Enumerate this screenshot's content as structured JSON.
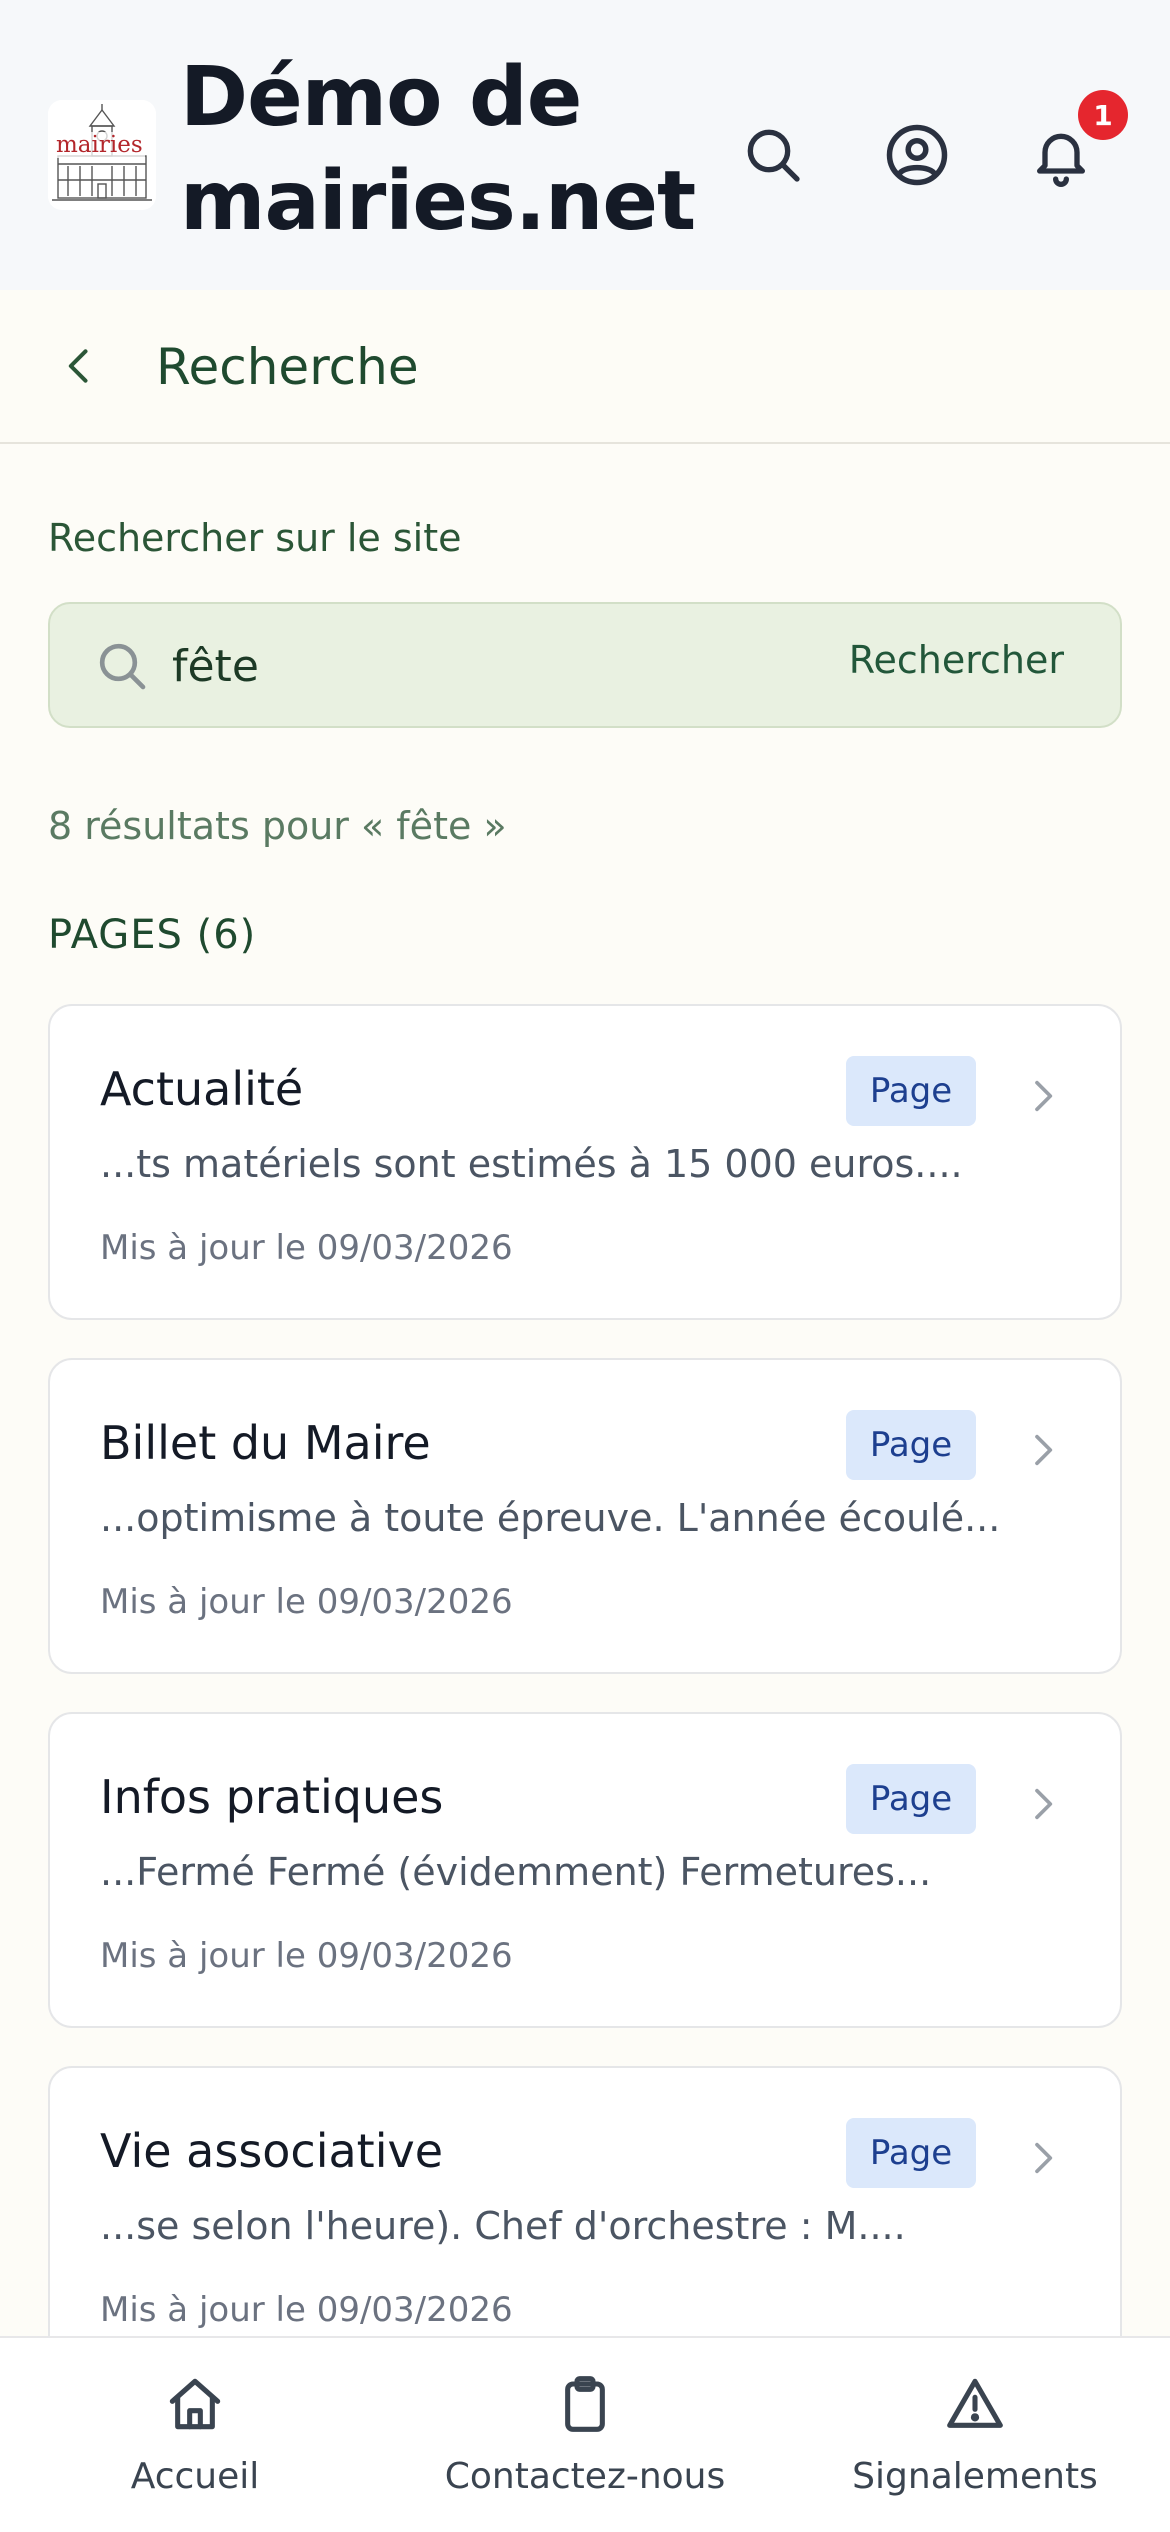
{
  "header": {
    "app_title": "Démo de mairies.net",
    "notification_count": "1",
    "logo_text": "mairies"
  },
  "page": {
    "title": "Recherche"
  },
  "search": {
    "label": "Rechercher sur le site",
    "value": "fête",
    "button_label": "Rechercher",
    "results_summary": "8 résultats pour « fête »"
  },
  "sections": {
    "pages_title": "PAGES (6)"
  },
  "results": [
    {
      "title": "Actualité",
      "badge": "Page",
      "excerpt": "...ts matériels sont estimés à 15 000 euros....",
      "date": "Mis à jour le 09/03/2026"
    },
    {
      "title": "Billet du Maire",
      "badge": "Page",
      "excerpt": "...optimisme à toute épreuve. L'année écoulé...",
      "date": "Mis à jour le 09/03/2026"
    },
    {
      "title": "Infos pratiques",
      "badge": "Page",
      "excerpt": "...Fermé Fermé (évidemment) Fermetures...",
      "date": "Mis à jour le 09/03/2026"
    },
    {
      "title": "Vie associative",
      "badge": "Page",
      "excerpt": "...se selon l'heure). Chef d'orchestre : M....",
      "date": "Mis à jour le 09/03/2026"
    }
  ],
  "bottom_nav": {
    "home": "Accueil",
    "contact": "Contactez-nous",
    "reports": "Signalements"
  },
  "colors": {
    "header_bg": "#f6f8fa",
    "accent_green": "#1f4a2f",
    "badge_bg": "#dbe8fb",
    "badge_text": "#1d3f8f",
    "notification_red": "#e5262e"
  }
}
